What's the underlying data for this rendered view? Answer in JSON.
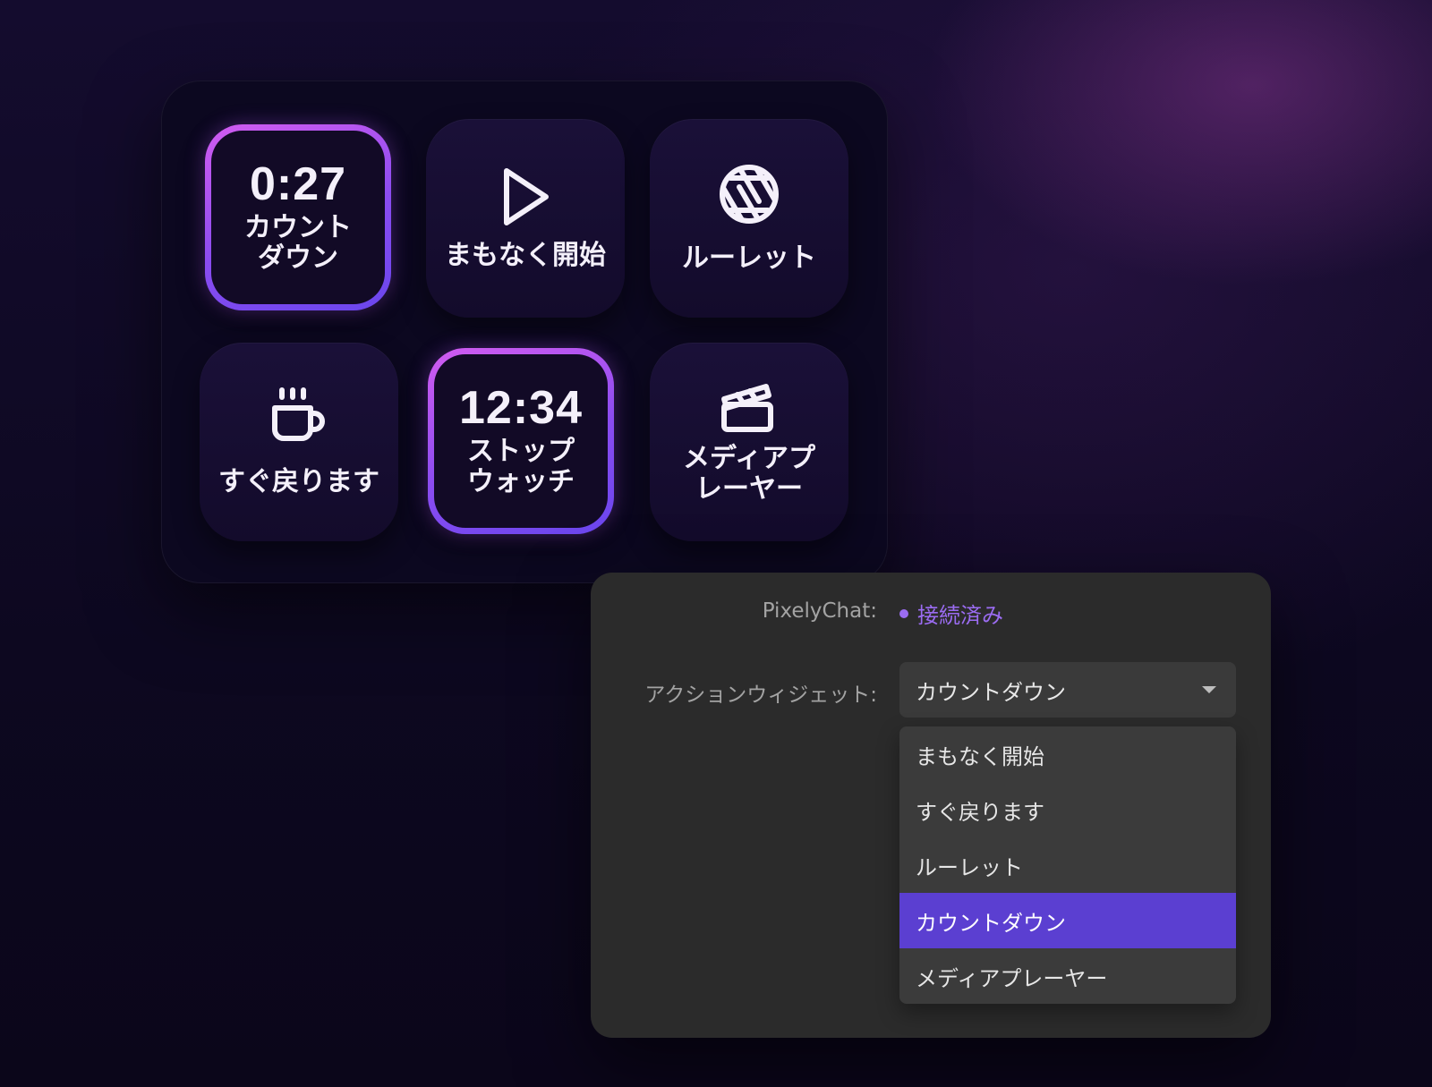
{
  "deck": {
    "keys": [
      {
        "time": "0:27",
        "label": "カウント\nダウン",
        "active": true
      },
      {
        "icon": "play-icon",
        "label": "まもなく開始"
      },
      {
        "icon": "aperture-icon",
        "label": "ルーレット"
      },
      {
        "icon": "coffee-cup-icon",
        "label": "すぐ戻ります"
      },
      {
        "time": "12:34",
        "label": "ストップ\nウォッチ",
        "active": true
      },
      {
        "icon": "clapperboard-icon",
        "label": "メディアプ\nレーヤー"
      }
    ]
  },
  "settings": {
    "connection_label": "PixelyChat:",
    "connection_status": "接続済み",
    "widget_label": "アクションウィジェット:",
    "widget_selected": "カウントダウン",
    "options": [
      "まもなく開始",
      "すぐ戻ります",
      "ルーレット",
      "カウントダウン",
      "メディアプレーヤー"
    ],
    "selected_index": 3
  },
  "colors": {
    "accent": "#5b3fd1",
    "status": "#9b6cf2",
    "key_border_start": "#d25cf0",
    "key_border_end": "#6a46ee"
  }
}
